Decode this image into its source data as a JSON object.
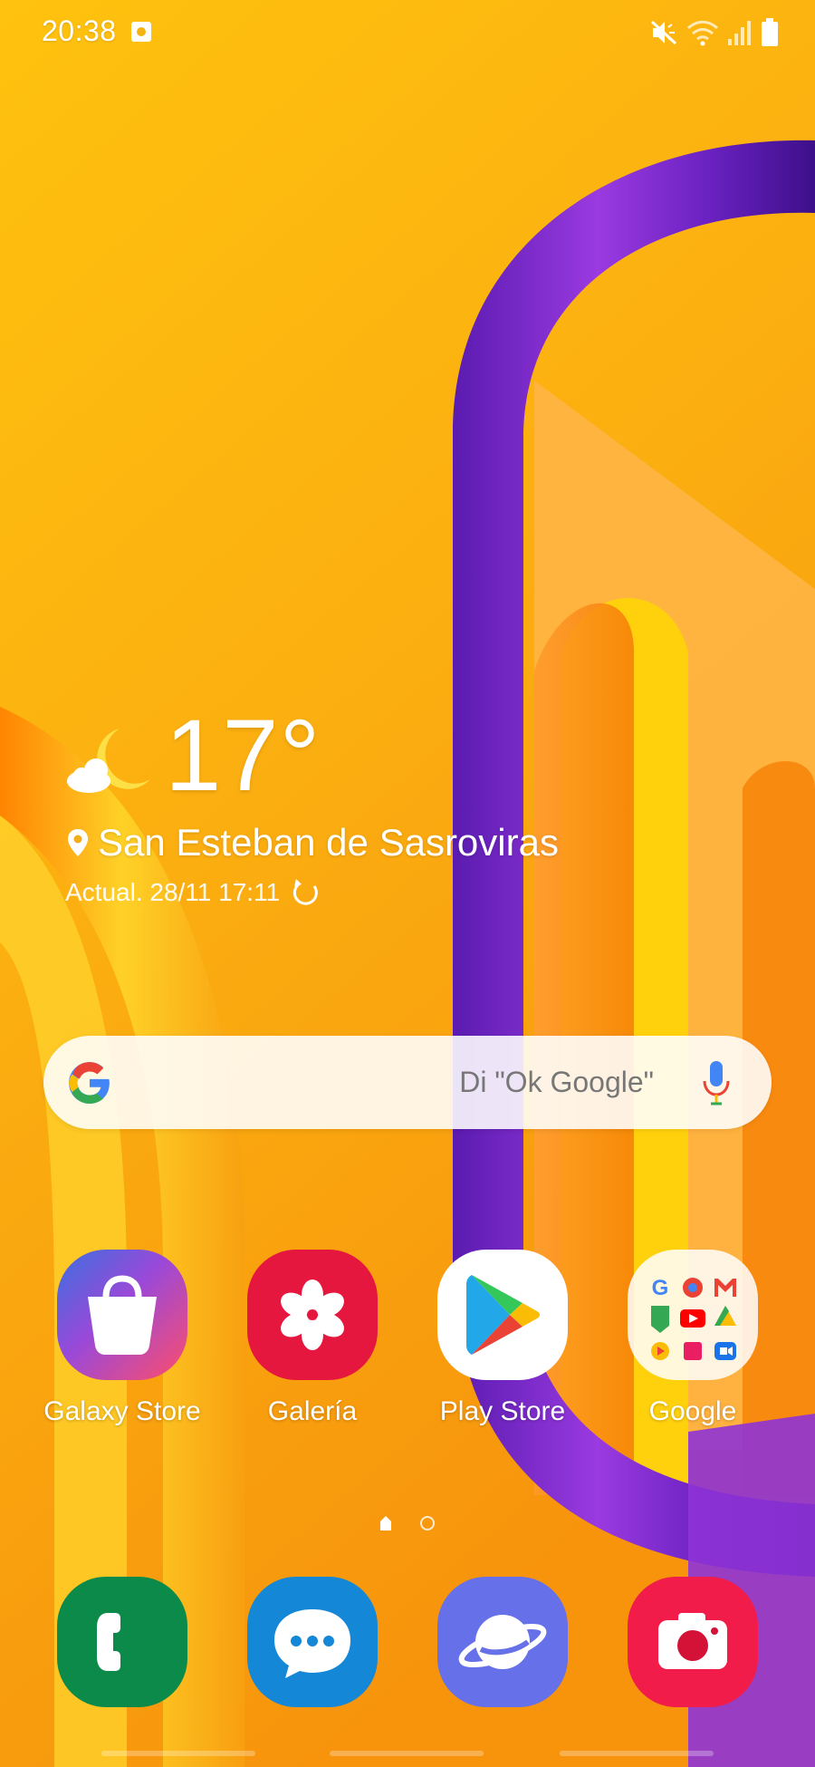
{
  "status_bar": {
    "time": "20:38",
    "icons": [
      "screenshot-notification-icon",
      "mute-icon",
      "wifi-icon",
      "signal-icon",
      "battery-icon"
    ]
  },
  "weather": {
    "temperature": "17°",
    "condition_icon": "partly-cloudy-night-icon",
    "location": "San Esteban de Sasroviras",
    "updated": "Actual. 28/11 17:11"
  },
  "search": {
    "hint": "Di \"Ok Google\""
  },
  "apps": [
    {
      "label": "Galaxy Store",
      "icon": "galaxy-store-icon"
    },
    {
      "label": "Galería",
      "icon": "gallery-icon"
    },
    {
      "label": "Play Store",
      "icon": "play-store-icon"
    },
    {
      "label": "Google",
      "icon": "google-folder-icon"
    }
  ],
  "page_indicator": {
    "pages": 2,
    "current": 1
  },
  "dock": [
    {
      "icon": "phone-icon"
    },
    {
      "icon": "messages-icon"
    },
    {
      "icon": "internet-browser-icon"
    },
    {
      "icon": "camera-icon"
    }
  ],
  "colors": {
    "wallpaper_yellow": "#fdc50a",
    "wallpaper_orange": "#f78d0c",
    "wallpaper_purple": "#7a2bd1"
  }
}
